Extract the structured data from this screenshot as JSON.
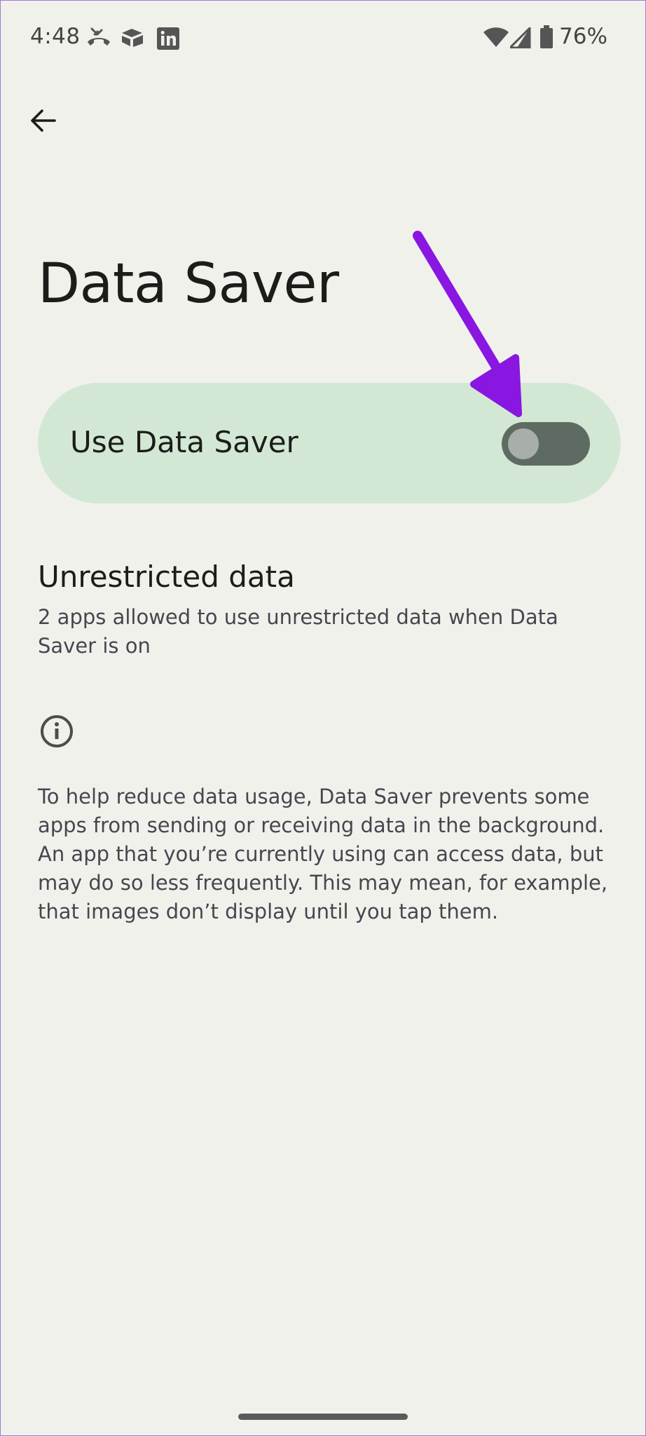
{
  "status_bar": {
    "time": "4:48",
    "notification_icons": [
      "missed-call-icon",
      "airtable-icon",
      "linkedin-icon"
    ],
    "wifi_icon": "wifi-icon",
    "signal_icon": "cell-signal-icon",
    "battery_icon": "battery-icon",
    "battery_percent": "76%"
  },
  "header": {
    "back_icon": "arrow-back-icon",
    "title": "Data Saver"
  },
  "data_saver_card": {
    "label": "Use Data Saver",
    "toggle_on": false,
    "color": "#d2e8d4"
  },
  "unrestricted": {
    "title": "Unrestricted data",
    "summary": "2 apps allowed to use unrestricted data when Data Saver is on"
  },
  "footer": {
    "info_icon": "info-icon",
    "text": "To help reduce data usage, Data Saver prevents some apps from sending or receiving data in the background. An app that you’re currently using can access data, but may do so less frequently. This may mean, for example, that images don’t display until you tap them."
  },
  "annotation": {
    "arrow_color": "#8a16e2"
  }
}
